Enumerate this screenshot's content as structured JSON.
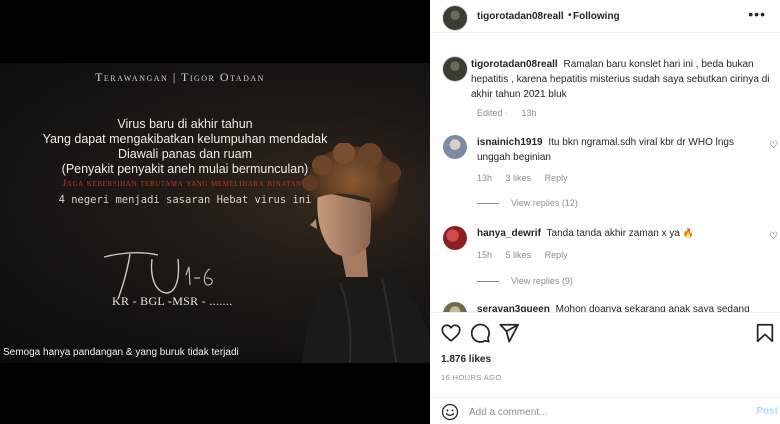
{
  "image": {
    "title": "Terawangan | Tigor Otadan",
    "lines": [
      "Virus baru di akhir tahun",
      "Yang dapat mengakibatkan kelumpuhan mendadak",
      "Diawali panas dan ruam",
      "(Penyakit penyakit aneh mulai bermunculan)"
    ],
    "warning_line": "Jaga kebersihan terutama yang memelihara binatang",
    "target_line": "4 negeri menjadi sasaran Hebat virus ini",
    "signature": "TU 1-6",
    "codes": "KR - BGL -MSR - .......",
    "footer": "Semoga hanya pandangan & yang buruk tidak terjadi"
  },
  "header": {
    "username": "tigorotadan08reall",
    "dot": "•",
    "follow_label": "Following",
    "more_icon": "more-horizontal-icon"
  },
  "caption": {
    "username": "tigorotadan08reall",
    "text": "Ramalan baru konslet hari ini , beda bukan hepatitis , karena hepatitis misterius sudah saya sebutkan cirinya di akhir tahun 2021 bluk",
    "edited": "Edited",
    "time": "13h"
  },
  "comments": [
    {
      "username": "isnainich1919",
      "text": "Itu bkn ngramal.sdh viral kbr dr WHO lngs unggah beginian",
      "time": "13h",
      "likes": "3 likes",
      "reply_label": "Reply",
      "view_replies": "View replies (12)"
    },
    {
      "username": "hanya_dewrif",
      "text": "Tanda tanda akhir zaman x ya",
      "emoji": "🔥",
      "time": "15h",
      "likes": "5 likes",
      "reply_label": "Reply",
      "view_replies": "View replies (9)"
    },
    {
      "username": "seravan3queen",
      "text": "Mohon doanya sekarang anak saya sedang"
    }
  ],
  "actions": {
    "like_icon": "heart-icon",
    "comment_icon": "comment-icon",
    "share_icon": "send-icon",
    "save_icon": "bookmark-icon"
  },
  "likes_count": "1.876 likes",
  "post_time": "16 HOURS AGO",
  "comment_box": {
    "placeholder": "Add a comment...",
    "post_label": "Post",
    "emoji_icon": "smiley-icon"
  },
  "colors": {
    "warning_red": "#c2342a",
    "post_button_disabled": "#b3dbff",
    "meta_gray": "#8e8e8e"
  }
}
